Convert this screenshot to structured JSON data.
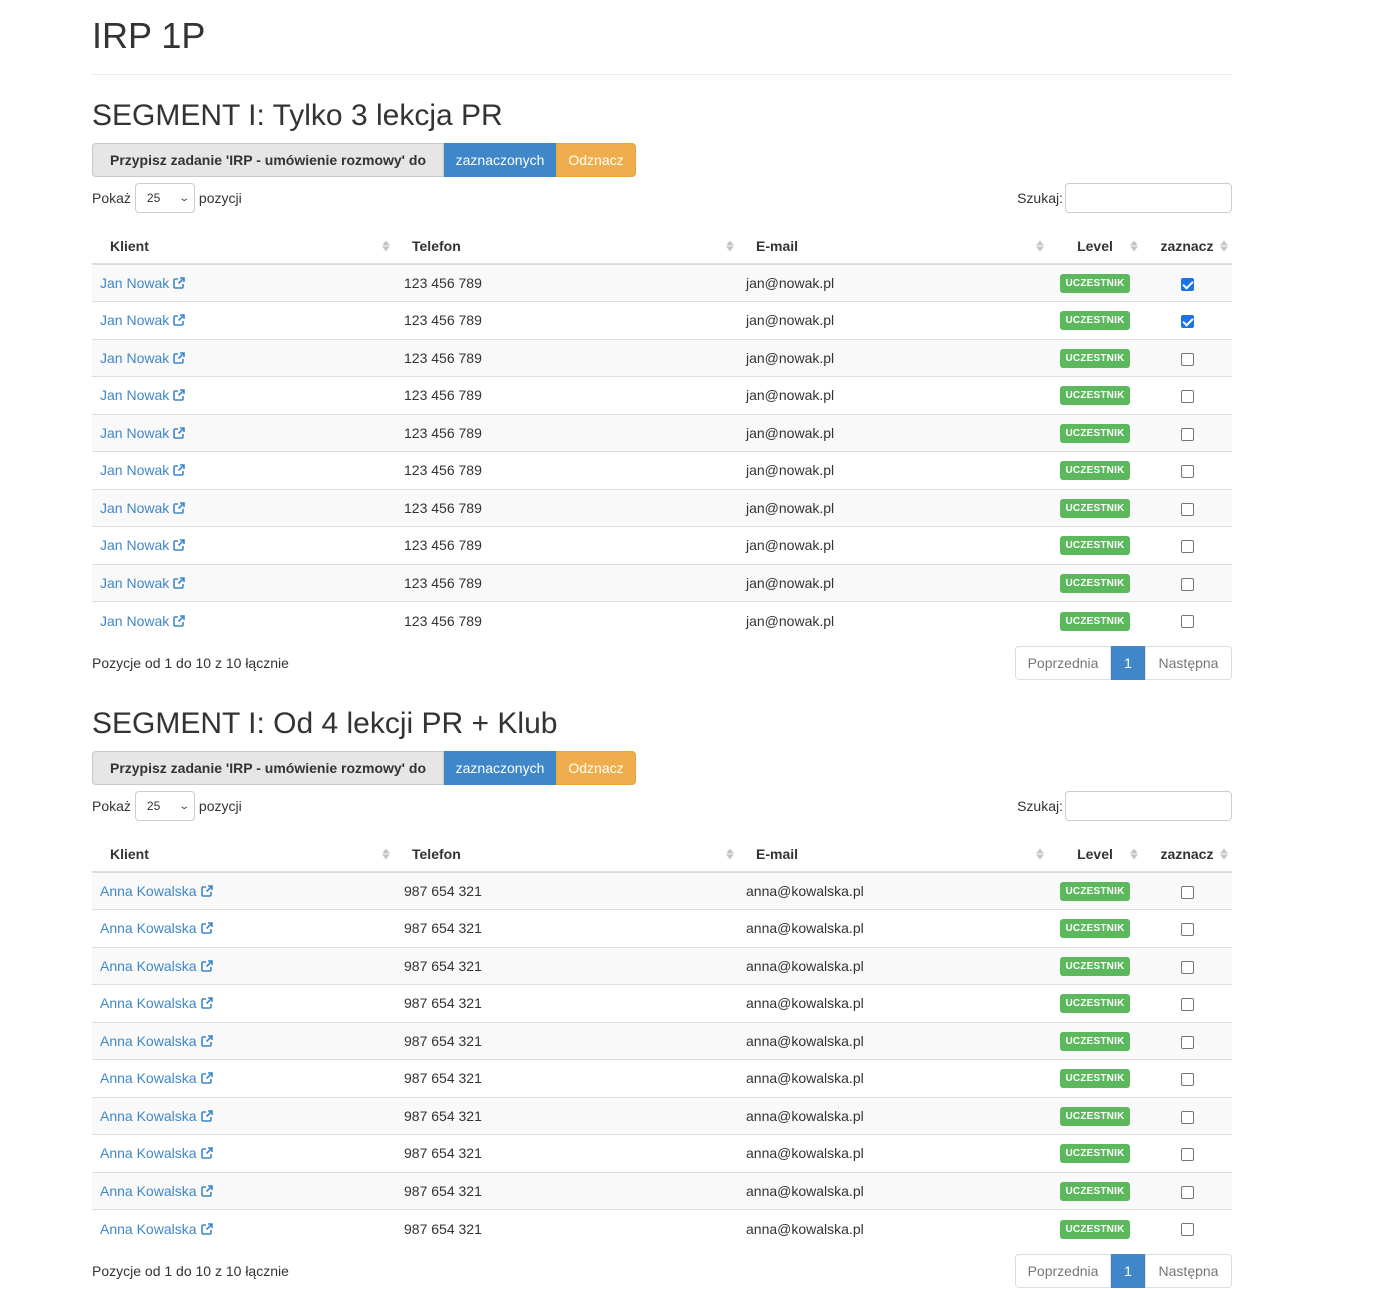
{
  "page": {
    "title": "IRP 1P"
  },
  "colors": {
    "primary": "#3f87c9",
    "warning": "#f0ad4e",
    "success": "#5cb85c"
  },
  "segments": [
    {
      "title": "SEGMENT I: Tylko 3 lekcja PR",
      "assign_label": "Przypisz zadanie 'IRP - umówienie rozmowy' do",
      "selected_button": "zaznaczonych",
      "unselect_button": "Odznacz",
      "length": {
        "prefix": "Pokaż",
        "value": "25",
        "suffix": "pozycji"
      },
      "search_label": "Szukaj:",
      "columns": [
        "Klient",
        "Telefon",
        "E-mail",
        "Level",
        "zaznacz"
      ],
      "rows": [
        {
          "client": "Jan Nowak",
          "phone": "123 456 789",
          "email": "jan@nowak.pl",
          "level": "UCZESTNIK",
          "checked": true
        },
        {
          "client": "Jan Nowak",
          "phone": "123 456 789",
          "email": "jan@nowak.pl",
          "level": "UCZESTNIK",
          "checked": true
        },
        {
          "client": "Jan Nowak",
          "phone": "123 456 789",
          "email": "jan@nowak.pl",
          "level": "UCZESTNIK",
          "checked": false
        },
        {
          "client": "Jan Nowak",
          "phone": "123 456 789",
          "email": "jan@nowak.pl",
          "level": "UCZESTNIK",
          "checked": false
        },
        {
          "client": "Jan Nowak",
          "phone": "123 456 789",
          "email": "jan@nowak.pl",
          "level": "UCZESTNIK",
          "checked": false
        },
        {
          "client": "Jan Nowak",
          "phone": "123 456 789",
          "email": "jan@nowak.pl",
          "level": "UCZESTNIK",
          "checked": false
        },
        {
          "client": "Jan Nowak",
          "phone": "123 456 789",
          "email": "jan@nowak.pl",
          "level": "UCZESTNIK",
          "checked": false
        },
        {
          "client": "Jan Nowak",
          "phone": "123 456 789",
          "email": "jan@nowak.pl",
          "level": "UCZESTNIK",
          "checked": false
        },
        {
          "client": "Jan Nowak",
          "phone": "123 456 789",
          "email": "jan@nowak.pl",
          "level": "UCZESTNIK",
          "checked": false
        },
        {
          "client": "Jan Nowak",
          "phone": "123 456 789",
          "email": "jan@nowak.pl",
          "level": "UCZESTNIK",
          "checked": false
        }
      ],
      "info": "Pozycje od 1 do 10 z 10 łącznie",
      "pagination": {
        "prev": "Poprzednia",
        "current": "1",
        "next": "Następna"
      }
    },
    {
      "title": "SEGMENT I: Od 4 lekcji PR + Klub",
      "assign_label": "Przypisz zadanie 'IRP - umówienie rozmowy' do",
      "selected_button": "zaznaczonych",
      "unselect_button": "Odznacz",
      "length": {
        "prefix": "Pokaż",
        "value": "25",
        "suffix": "pozycji"
      },
      "search_label": "Szukaj:",
      "columns": [
        "Klient",
        "Telefon",
        "E-mail",
        "Level",
        "zaznacz"
      ],
      "rows": [
        {
          "client": "Anna Kowalska",
          "phone": "987 654 321",
          "email": "anna@kowalska.pl",
          "level": "UCZESTNIK",
          "checked": false
        },
        {
          "client": "Anna Kowalska",
          "phone": "987 654 321",
          "email": "anna@kowalska.pl",
          "level": "UCZESTNIK",
          "checked": false
        },
        {
          "client": "Anna Kowalska",
          "phone": "987 654 321",
          "email": "anna@kowalska.pl",
          "level": "UCZESTNIK",
          "checked": false
        },
        {
          "client": "Anna Kowalska",
          "phone": "987 654 321",
          "email": "anna@kowalska.pl",
          "level": "UCZESTNIK",
          "checked": false
        },
        {
          "client": "Anna Kowalska",
          "phone": "987 654 321",
          "email": "anna@kowalska.pl",
          "level": "UCZESTNIK",
          "checked": false
        },
        {
          "client": "Anna Kowalska",
          "phone": "987 654 321",
          "email": "anna@kowalska.pl",
          "level": "UCZESTNIK",
          "checked": false
        },
        {
          "client": "Anna Kowalska",
          "phone": "987 654 321",
          "email": "anna@kowalska.pl",
          "level": "UCZESTNIK",
          "checked": false
        },
        {
          "client": "Anna Kowalska",
          "phone": "987 654 321",
          "email": "anna@kowalska.pl",
          "level": "UCZESTNIK",
          "checked": false
        },
        {
          "client": "Anna Kowalska",
          "phone": "987 654 321",
          "email": "anna@kowalska.pl",
          "level": "UCZESTNIK",
          "checked": false
        },
        {
          "client": "Anna Kowalska",
          "phone": "987 654 321",
          "email": "anna@kowalska.pl",
          "level": "UCZESTNIK",
          "checked": false
        }
      ],
      "info": "Pozycje od 1 do 10 z 10 łącznie",
      "pagination": {
        "prev": "Poprzednia",
        "current": "1",
        "next": "Następna"
      }
    }
  ]
}
